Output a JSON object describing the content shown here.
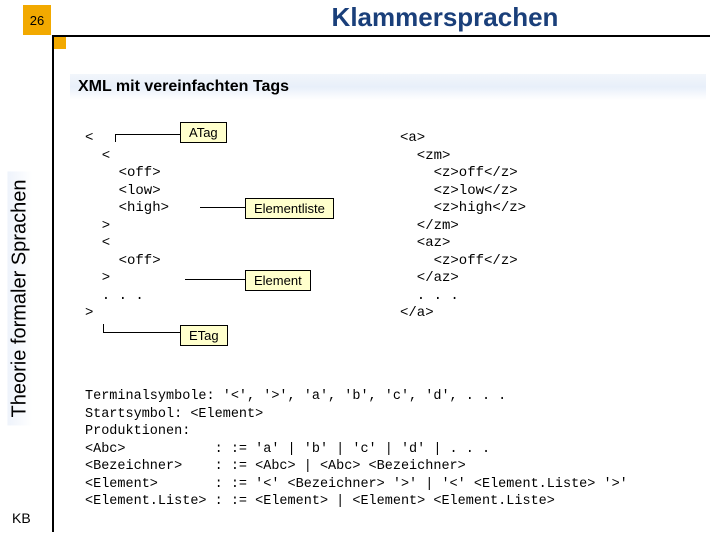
{
  "page_number": "26",
  "title": "Klammersprachen",
  "subtitle": "XML mit vereinfachten Tags",
  "sidebar_label": "Theorie formaler Sprachen",
  "footer_label": "KB",
  "callouts": {
    "atag": "ATag",
    "elist": "Elementliste",
    "elem": "Element",
    "etag": "ETag"
  },
  "code_left": "<\n  <\n    <off>\n    <low>\n    <high>\n  >\n  <\n    <off>\n  >\n  . . .\n>",
  "code_right": "<a>\n  <zm>\n    <z>off</z>\n    <z>low</z>\n    <z>high</z>\n  </zm>\n  <az>\n    <z>off</z>\n  </az>\n  . . .\n</a>",
  "grammar": "Terminalsymbole: '<', '>', 'a', 'b', 'c', 'd', . . .\nStartsymbol: <Element>\nProduktionen:\n<Abc>           : := 'a' | 'b' | 'c' | 'd' | . . .\n<Bezeichner>    : := <Abc> | <Abc> <Bezeichner>\n<Element>       : := '<' <Bezeichner> '>' | '<' <Element.Liste> '>'\n<Element.Liste> : := <Element> | <Element> <Element.Liste>"
}
